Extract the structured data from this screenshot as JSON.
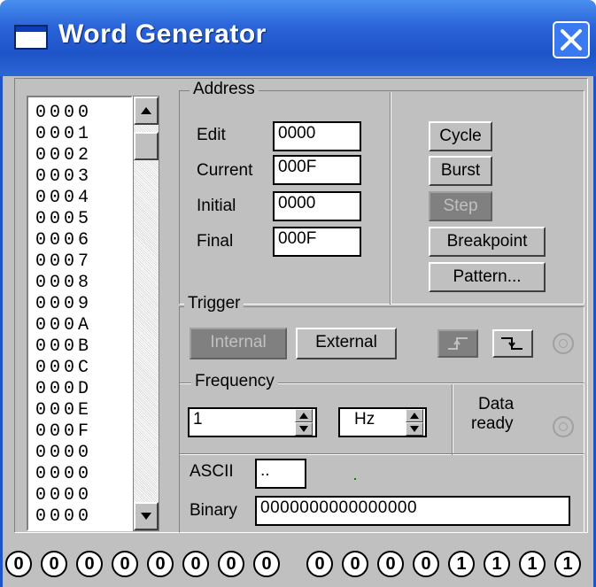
{
  "window": {
    "title": "Word Generator",
    "close_glyph": "✕"
  },
  "word_list": [
    "0000",
    "0001",
    "0002",
    "0003",
    "0004",
    "0005",
    "0006",
    "0007",
    "0008",
    "0009",
    "000A",
    "000B",
    "000C",
    "000D",
    "000E",
    "000F",
    "0000",
    "0000",
    "0000",
    "0000"
  ],
  "address": {
    "group_label": "Address",
    "edit_label": "Edit",
    "edit_value": "0000",
    "current_label": "Current",
    "current_value": "000F",
    "initial_label": "Initial",
    "initial_value": "0000",
    "final_label": "Final",
    "final_value": "000F"
  },
  "controls": {
    "cycle": "Cycle",
    "burst": "Burst",
    "step": "Step",
    "breakpoint": "Breakpoint",
    "pattern": "Pattern..."
  },
  "trigger": {
    "group_label": "Trigger",
    "internal": "Internal",
    "external": "External",
    "rising_icon": "rising-edge-icon",
    "falling_icon": "falling-edge-icon"
  },
  "frequency": {
    "group_label": "Frequency",
    "value": "1",
    "unit": "Hz"
  },
  "data_ready": {
    "line1": "Data",
    "line2": "ready"
  },
  "ascii": {
    "label": "ASCII",
    "value": ".."
  },
  "binary": {
    "label": "Binary",
    "value": "0000000000000000"
  },
  "bits": [
    "0",
    "0",
    "0",
    "0",
    "0",
    "0",
    "0",
    "0",
    "0",
    "0",
    "0",
    "0",
    "1",
    "1",
    "1",
    "1"
  ],
  "colors": {
    "titlebar": "#2a64d8",
    "face": "#c0c0c0",
    "disabled": "#808080"
  }
}
